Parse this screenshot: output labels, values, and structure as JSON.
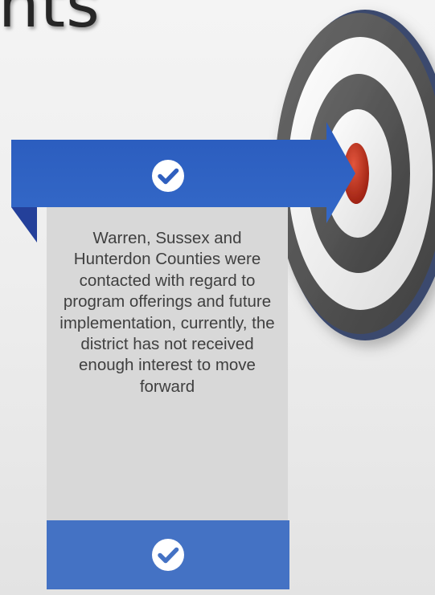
{
  "slide": {
    "title_fragment": "nts",
    "card_text": "Warren, Sussex and Hunterdon Counties were contacted with regard to program offerings and future implementation, currently, the district has not received enough interest to move forward"
  },
  "icons": {
    "top_check": "check-circle-icon",
    "bottom_check": "check-circle-icon",
    "target": "bullseye-target-icon"
  },
  "colors": {
    "arrow_blue": "#2f5fbf",
    "arrow_fold": "#24409a",
    "bar_blue": "#4472c4",
    "card_gray": "#d8d8d8",
    "bullseye_red": "#c0301d",
    "ring_dark": "#5a5a5a",
    "ring_light": "#f2f2f2",
    "title_text": "#262626",
    "body_text": "#3f3f3f"
  }
}
